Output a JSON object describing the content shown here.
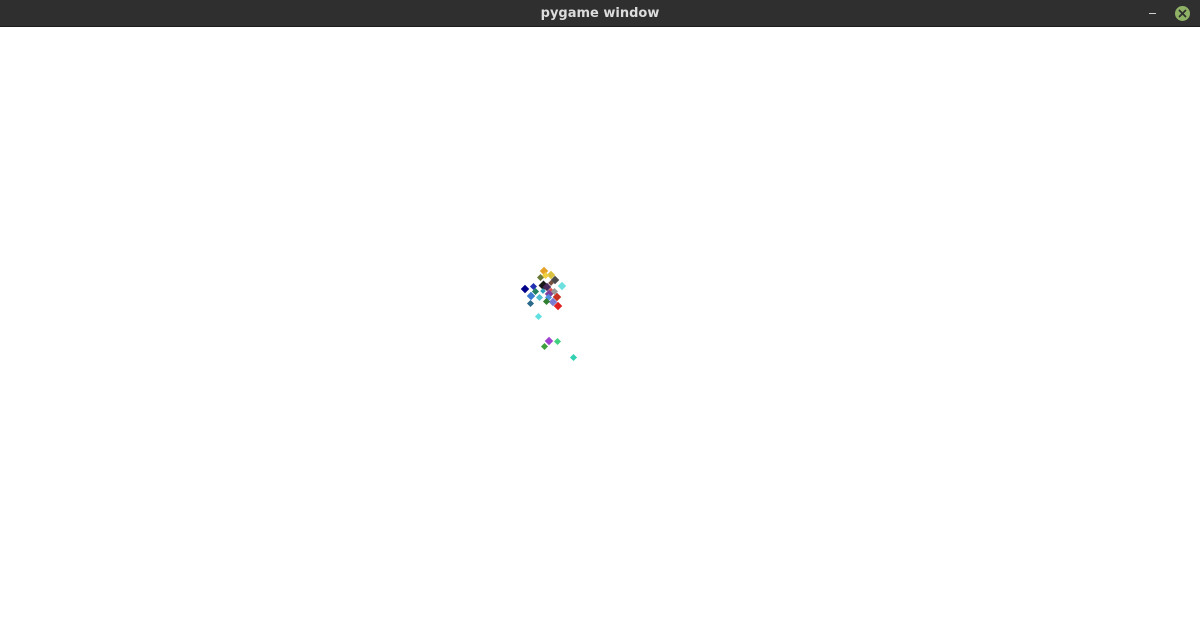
{
  "window": {
    "title": "pygame window"
  },
  "titlebar_icons": {
    "minimize": "minimize-icon",
    "close": "close-icon"
  },
  "colors": {
    "titlebar_bg": "#2f2f2f",
    "title_text": "#dcdcdc",
    "close_button": "#8fb166",
    "canvas_bg": "#ffffff"
  },
  "game": {
    "entities": [
      {
        "color": "#e6a128"
      },
      {
        "color": "#d8c040"
      },
      {
        "color": "#6a7a3a"
      },
      {
        "color": "#4a4a4a"
      },
      {
        "color": "#000088"
      },
      {
        "color": "#2030b0"
      },
      {
        "color": "#1a1a1a"
      },
      {
        "color": "#4a2a5a"
      },
      {
        "color": "#e05050"
      },
      {
        "color": "#c83020"
      },
      {
        "color": "#3a7ad0"
      },
      {
        "color": "#50c0d0"
      },
      {
        "color": "#6fe0e0"
      },
      {
        "color": "#9a9a9a"
      },
      {
        "color": "#8040a0"
      },
      {
        "color": "#208060"
      },
      {
        "color": "#e02020"
      },
      {
        "color": "#7a7ad0"
      },
      {
        "color": "#2a6a8a"
      },
      {
        "color": "#5090e0"
      },
      {
        "color": "#308030"
      },
      {
        "color": "#30a0c0"
      },
      {
        "color": "#7a5040"
      },
      {
        "color": "#f0d040"
      },
      {
        "color": "#60e0e0"
      },
      {
        "color": "#a040d0"
      },
      {
        "color": "#40a040"
      },
      {
        "color": "#40d080"
      },
      {
        "color": "#30d0b0"
      }
    ]
  }
}
